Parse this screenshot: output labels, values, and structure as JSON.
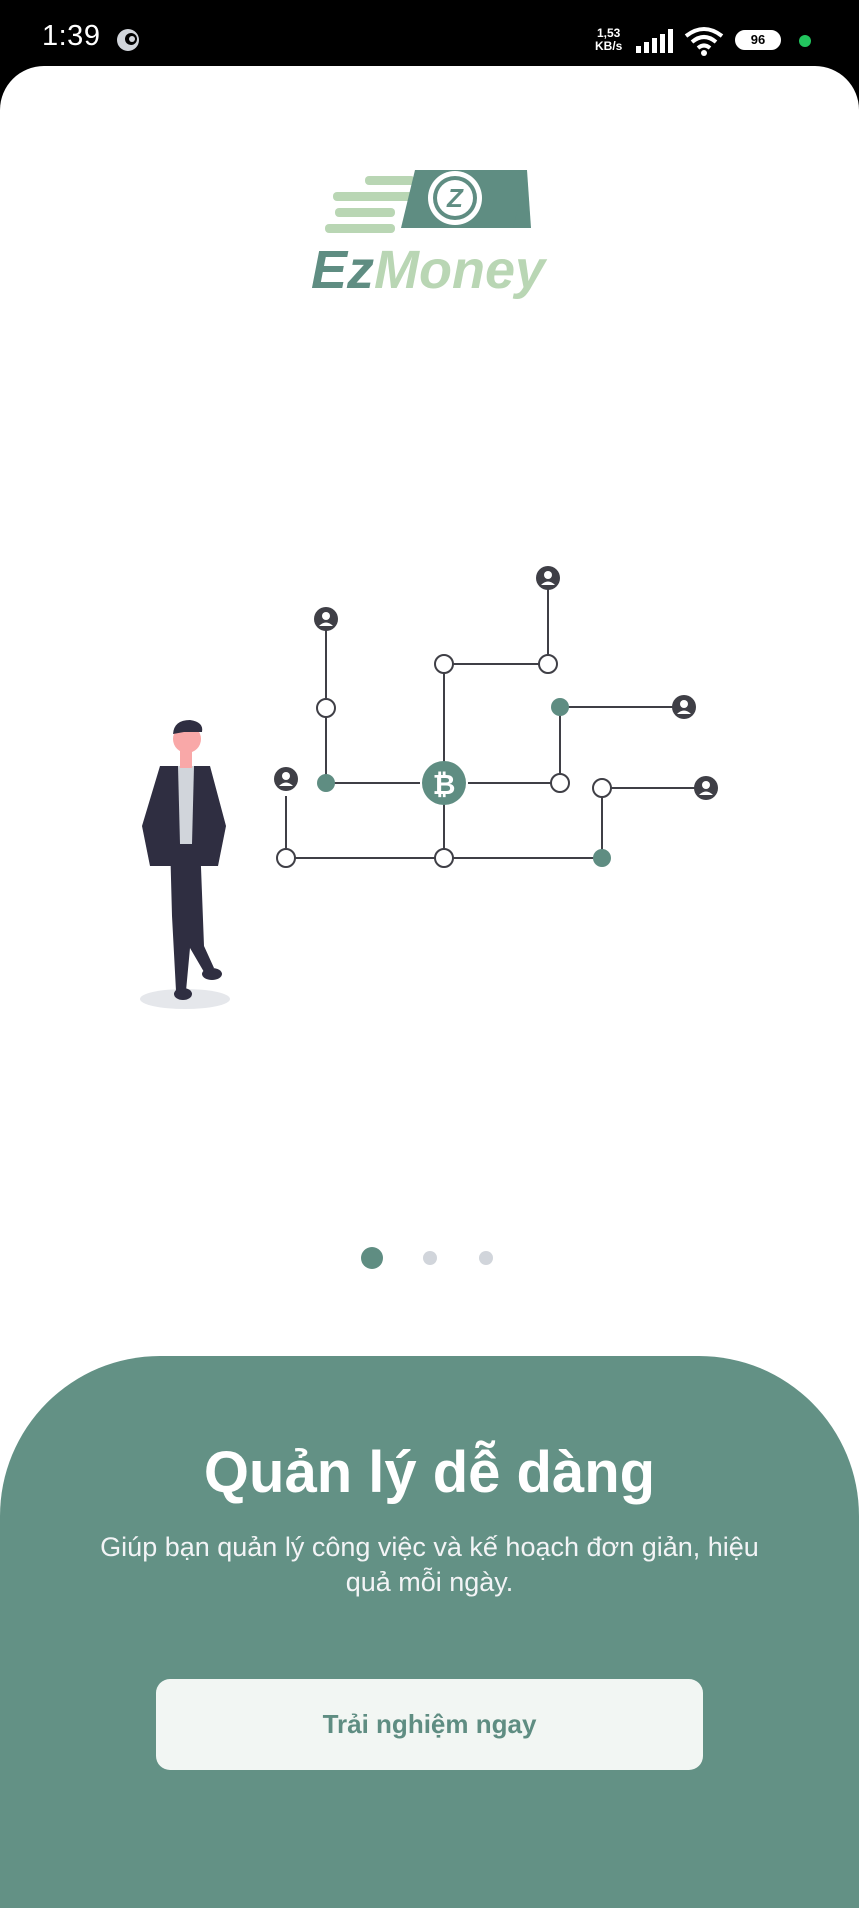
{
  "status_bar": {
    "time": "1:39",
    "net_speed_value": "1,53",
    "net_speed_unit": "KB/s",
    "battery": "96",
    "app_icon": "chat-bubble-icon",
    "icons": [
      "signal-icon",
      "wifi-icon",
      "battery-icon",
      "active-dot-icon"
    ]
  },
  "logo": {
    "brand_part1": "Ez",
    "brand_part2": "Money",
    "badge_letter": "Z",
    "colors": {
      "dark": "#5f8d82",
      "light": "#b9d6b4"
    }
  },
  "illustration": {
    "subject": "businessman-network-illustration",
    "center_symbol": "bitcoin-icon"
  },
  "pager": {
    "count": 3,
    "active_index": 0
  },
  "onboarding": {
    "title": "Quản lý dễ dàng",
    "subtitle": "Giúp bạn quản lý công việc và kế hoạch đơn giản, hiệu quả mỗi ngày.",
    "cta_label": "Trải nghiệm ngay"
  },
  "colors": {
    "accent": "#639185",
    "accent_dark": "#5f8d82",
    "button_bg": "#f2f6f3",
    "dot_inactive": "#d1d5db"
  }
}
